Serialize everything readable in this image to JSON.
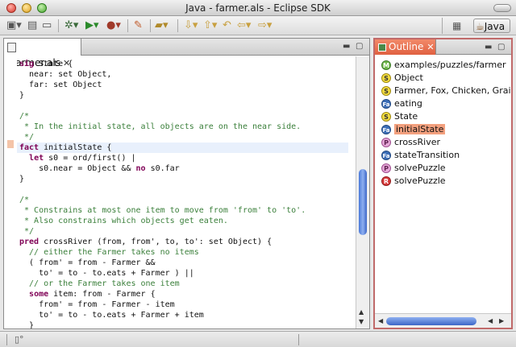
{
  "window": {
    "title": "Java - farmer.als - Eclipse SDK"
  },
  "toolbar": {
    "icons": [
      "new-wizard-icon",
      "save-icon",
      "print-icon",
      "debug-icon",
      "run-icon",
      "external-tools-icon",
      "edit-icon",
      "open-type-icon",
      "next-annotation-icon",
      "previous-annotation-icon",
      "back-icon",
      "forward-icon"
    ]
  },
  "perspective": {
    "label": "Java"
  },
  "editor": {
    "tab_label": "*farmer.als",
    "lines": [
      {
        "text": "sig State {",
        "kind": "code"
      },
      {
        "text": "  near: set Object,",
        "kind": "code"
      },
      {
        "text": "  far: set Object",
        "kind": "code"
      },
      {
        "text": "}",
        "kind": "code"
      },
      {
        "text": "",
        "kind": "code"
      },
      {
        "text": "/*",
        "kind": "comment"
      },
      {
        "text": " * In the initial state, all objects are on the near side.",
        "kind": "comment"
      },
      {
        "text": " */",
        "kind": "comment"
      },
      {
        "text": "fact initialState {",
        "kind": "code",
        "highlight": true,
        "marker": true
      },
      {
        "text": "  let s0 = ord/first() |",
        "kind": "code"
      },
      {
        "text": "    s0.near = Object && no s0.far",
        "kind": "code"
      },
      {
        "text": "}",
        "kind": "code"
      },
      {
        "text": "",
        "kind": "code"
      },
      {
        "text": "/*",
        "kind": "comment"
      },
      {
        "text": " * Constrains at most one item to move from 'from' to 'to'.",
        "kind": "comment"
      },
      {
        "text": " * Also constrains which objects get eaten.",
        "kind": "comment"
      },
      {
        "text": " */",
        "kind": "comment"
      },
      {
        "text": "pred crossRiver (from, from', to, to': set Object) {",
        "kind": "code"
      },
      {
        "text": "  // either the Farmer takes no items",
        "kind": "comment"
      },
      {
        "text": "  ( from' = from - Farmer &&",
        "kind": "code"
      },
      {
        "text": "    to' = to - to.eats + Farmer ) ||",
        "kind": "code"
      },
      {
        "text": "  // or the Farmer takes one item",
        "kind": "comment"
      },
      {
        "text": "  some item: from - Farmer {",
        "kind": "code"
      },
      {
        "text": "    from' = from - Farmer - item",
        "kind": "code"
      },
      {
        "text": "    to' = to - to.eats + Farmer + item",
        "kind": "code"
      },
      {
        "text": "  }",
        "kind": "code"
      }
    ]
  },
  "outline": {
    "tab_label": "Outline",
    "items": [
      {
        "badge": "M",
        "label": "examples/puzzles/farmer"
      },
      {
        "badge": "S",
        "label": "Object"
      },
      {
        "badge": "S",
        "label": "Farmer, Fox, Chicken, Grain"
      },
      {
        "badge": "Fa",
        "label": "eating"
      },
      {
        "badge": "S",
        "label": "State"
      },
      {
        "badge": "Fa",
        "label": "initialState",
        "selected": true
      },
      {
        "badge": "P",
        "label": "crossRiver"
      },
      {
        "badge": "Fa",
        "label": "stateTransition"
      },
      {
        "badge": "P",
        "label": "solvePuzzle"
      },
      {
        "badge": "R",
        "label": "solvePuzzle"
      }
    ]
  },
  "statusbar": {
    "icon": "new-task-icon"
  }
}
